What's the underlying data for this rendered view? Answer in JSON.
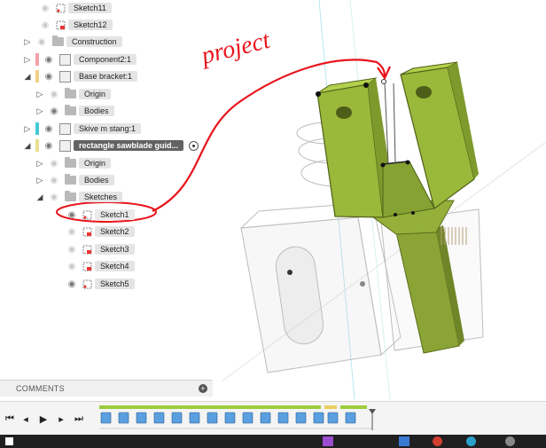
{
  "browser": {
    "items": [
      {
        "label": "Sketch11"
      },
      {
        "label": "Sketch12"
      },
      {
        "label": "Construction"
      },
      {
        "label": "Component2:1"
      },
      {
        "label": "Base bracket:1"
      },
      {
        "label": "Origin"
      },
      {
        "label": "Bodies"
      },
      {
        "label": "Skive m stang:1"
      },
      {
        "label": "rectangle sawblade guid..."
      },
      {
        "label": "Origin"
      },
      {
        "label": "Bodies"
      },
      {
        "label": "Sketches"
      },
      {
        "label": "Sketch1"
      },
      {
        "label": "Sketch2"
      },
      {
        "label": "Sketch3"
      },
      {
        "label": "Sketch4"
      },
      {
        "label": "Sketch5"
      }
    ]
  },
  "comments": {
    "label": "COMMENTS"
  },
  "annotation": {
    "text": "project"
  },
  "colors": {
    "body_green": "#9ab83a",
    "annotation_red": "#e8141c",
    "component2_chip": "#f0a0a8",
    "skive_chip": "#44c8d8",
    "rect_chip": "#e8e090",
    "timeline_green": "#9ccc3c"
  }
}
